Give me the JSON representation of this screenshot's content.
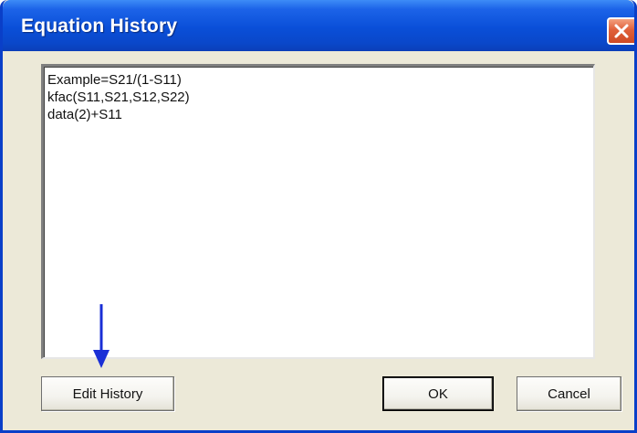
{
  "window": {
    "title": "Equation History",
    "close_icon": "close-icon"
  },
  "history": {
    "items": [
      "Example=S21/(1-S11)",
      "kfac(S11,S21,S12,S22)",
      "data(2)+S11"
    ]
  },
  "buttons": {
    "edit_history": "Edit History",
    "ok": "OK",
    "cancel": "Cancel"
  },
  "annotation": {
    "icon": "down-arrow-icon",
    "color": "#1a2fd6"
  },
  "colors": {
    "titlebar": "#0a4fd8",
    "dialog_bg": "#ece9d8",
    "close_button": "#e0603a"
  }
}
